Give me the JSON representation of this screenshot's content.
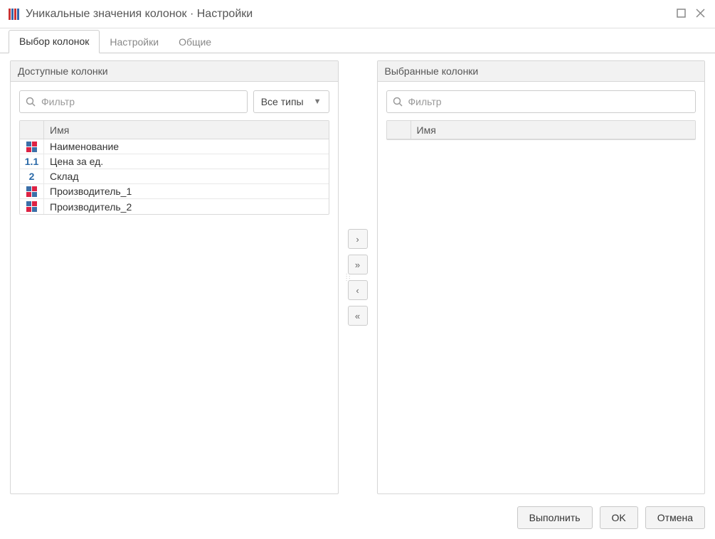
{
  "window": {
    "title": "Уникальные значения колонок · Настройки"
  },
  "tabs": [
    {
      "label": "Выбор колонок",
      "active": true
    },
    {
      "label": "Настройки",
      "active": false
    },
    {
      "label": "Общие",
      "active": false
    }
  ],
  "panels": {
    "available": {
      "title": "Доступные колонки",
      "filter_placeholder": "Фильтр",
      "type_filter": "Все типы",
      "col_header": "Имя",
      "rows": [
        {
          "icon": "grid",
          "name": "Наименование"
        },
        {
          "icon": "num11",
          "name": "Цена за ед."
        },
        {
          "icon": "num2",
          "name": "Склад"
        },
        {
          "icon": "grid",
          "name": "Производитель_1"
        },
        {
          "icon": "grid",
          "name": "Производитель_2"
        }
      ]
    },
    "selected": {
      "title": "Выбранные колонки",
      "filter_placeholder": "Фильтр",
      "col_header": "Имя",
      "rows": []
    }
  },
  "mover": {
    "add": "›",
    "add_all": "»",
    "remove": "‹",
    "remove_all": "«"
  },
  "footer": {
    "run": "Выполнить",
    "ok": "OK",
    "cancel": "Отмена"
  }
}
